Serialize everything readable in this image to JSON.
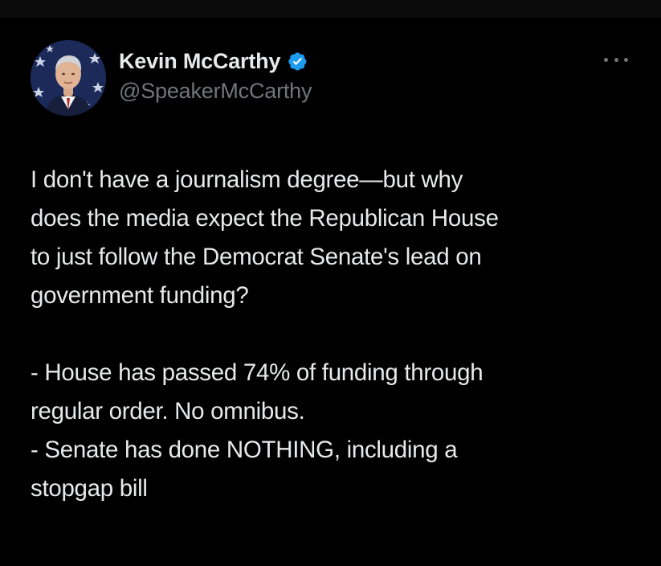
{
  "author": {
    "display_name": "Kevin McCarthy",
    "handle": "@SpeakerMcCarthy",
    "verified": true,
    "verified_icon": "verified-badge-icon",
    "verified_color": "#1d9bf0"
  },
  "menu": {
    "icon": "more-options-icon"
  },
  "tweet": {
    "lines": [
      "I don't have a journalism degree—but why",
      "does the media expect the Republican House",
      "to just follow the Democrat Senate's lead on",
      "government funding?",
      "- House has passed 74% of funding through",
      "regular order. No omnibus.",
      "- Senate has done NOTHING, including a",
      "stopgap bill"
    ]
  },
  "colors": {
    "background": "#000000",
    "text": "#e7e9ea",
    "secondary_text": "#71767b"
  }
}
